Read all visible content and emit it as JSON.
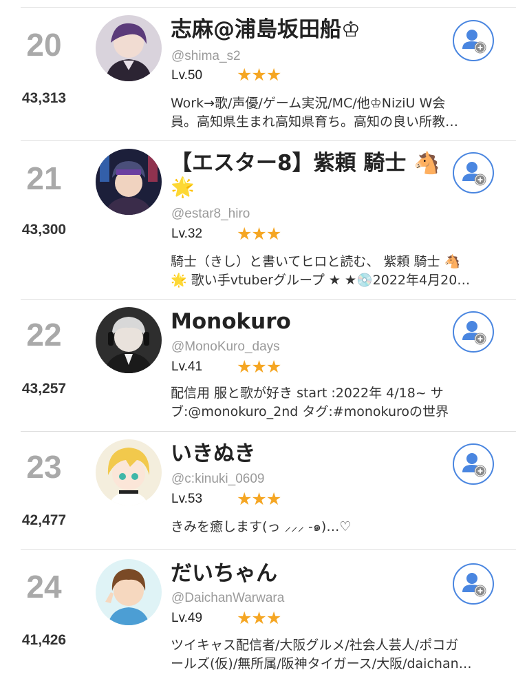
{
  "accent_color": "#4a86e0",
  "star_color": "#f5a623",
  "rows": [
    {
      "rank": "20",
      "score": "43,313",
      "name": "志麻@浦島坂田船♔",
      "name_line2": "",
      "handle": "@shima_s2",
      "level": "Lv.50",
      "stars": "★★★",
      "bio_line1": "Work→歌/声優/ゲーム実況/MC/他♔NiziU W会",
      "bio_line2": "員。高知県生まれ高知県育ち。高知の良い所教…",
      "follow_icon": "follow-user-icon"
    },
    {
      "rank": "21",
      "score": "43,300",
      "name": "【エスター8】紫頼 騎士 🐴",
      "name_line2": "🌟",
      "handle": "@estar8_hiro",
      "level": "Lv.32",
      "stars": "★★★",
      "bio_line1": "騎士（きし）と書いてヒロと読む、 紫頼 騎士 🐴",
      "bio_line2": "🌟 歌い手vtuberグループ ★ ★💿2022年4月20…",
      "follow_icon": "follow-user-icon"
    },
    {
      "rank": "22",
      "score": "43,257",
      "name": "Monokuro",
      "name_line2": "",
      "handle": "@MonoKuro_days",
      "level": "Lv.41",
      "stars": "★★★",
      "bio_line1": "配信用 服と歌が好き start :2022年 4/18~ サ",
      "bio_line2": "ブ:@monokuro_2nd タグ:#monokuroの世界",
      "follow_icon": "follow-user-icon"
    },
    {
      "rank": "23",
      "score": "42,477",
      "name": "いきぬき",
      "name_line2": "",
      "handle": "@c:kinuki_0609",
      "level": "Lv.53",
      "stars": "★★★",
      "bio_line1": "きみを癒します(っ ⸝⸝⸝ -๑)…♡",
      "bio_line2": "",
      "follow_icon": "follow-user-icon"
    },
    {
      "rank": "24",
      "score": "41,426",
      "name": "だいちゃん",
      "name_line2": "",
      "handle": "@DaichanWarwara",
      "level": "Lv.49",
      "stars": "★★★",
      "bio_line1": "ツイキャス配信者/大阪グルメ/社会人芸人/ポコガ",
      "bio_line2": "ールズ(仮)/無所属/阪神タイガース/大阪/daichan…",
      "follow_icon": "follow-user-icon"
    }
  ]
}
